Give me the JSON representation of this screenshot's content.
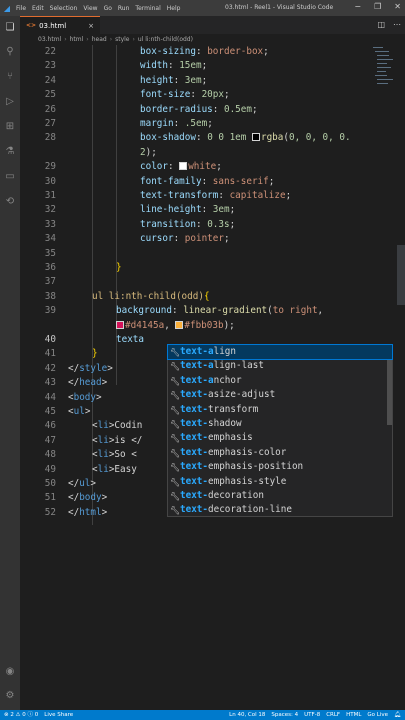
{
  "titlebar": {
    "menu": [
      "File",
      "Edit",
      "Selection",
      "View",
      "Go",
      "Run",
      "Terminal",
      "Help"
    ],
    "title": "03.html - Reel1 - Visual Studio Code"
  },
  "tab": {
    "badge": "<>",
    "name": "03.html",
    "close": "×"
  },
  "breadcrumb": [
    "03.html",
    "html",
    "head",
    "style",
    "ul li:nth-child(odd)"
  ],
  "editor": {
    "lines": [
      {
        "n": "22",
        "segments": [
          [
            "prop",
            "box-sizing"
          ],
          [
            "punc",
            ": "
          ],
          [
            "val",
            "border-box"
          ],
          [
            "punc",
            ";"
          ]
        ]
      },
      {
        "n": "23",
        "segments": [
          [
            "prop",
            "width"
          ],
          [
            "punc",
            ": "
          ],
          [
            "num",
            "15em"
          ],
          [
            "punc",
            ";"
          ]
        ]
      },
      {
        "n": "24",
        "segments": [
          [
            "prop",
            "height"
          ],
          [
            "punc",
            ": "
          ],
          [
            "num",
            "3em"
          ],
          [
            "punc",
            ";"
          ]
        ]
      },
      {
        "n": "25",
        "segments": [
          [
            "prop",
            "font-size"
          ],
          [
            "punc",
            ": "
          ],
          [
            "num",
            "20px"
          ],
          [
            "punc",
            ";"
          ]
        ]
      },
      {
        "n": "26",
        "segments": [
          [
            "prop",
            "border-radius"
          ],
          [
            "punc",
            ": "
          ],
          [
            "num",
            "0.5em"
          ],
          [
            "punc",
            ";"
          ]
        ]
      },
      {
        "n": "27",
        "segments": [
          [
            "prop",
            "margin"
          ],
          [
            "punc",
            ": "
          ],
          [
            "num",
            ".5em"
          ],
          [
            "punc",
            ";"
          ]
        ]
      },
      {
        "n": "28",
        "segments": [
          [
            "prop",
            "box-shadow"
          ],
          [
            "punc",
            ": "
          ],
          [
            "num",
            "0 0 1em "
          ],
          [
            "swatch",
            "#000000"
          ],
          [
            "func",
            "rgba"
          ],
          [
            "punc",
            "("
          ],
          [
            "num",
            "0, 0, 0, 0."
          ]
        ]
      },
      {
        "n": "",
        "segments": [
          [
            "num",
            "2"
          ],
          [
            "punc",
            ");"
          ]
        ]
      },
      {
        "n": "29",
        "segments": [
          [
            "prop",
            "color"
          ],
          [
            "punc",
            ": "
          ],
          [
            "swatch",
            "#ffffff"
          ],
          [
            "val",
            "white"
          ],
          [
            "punc",
            ";"
          ]
        ]
      },
      {
        "n": "30",
        "segments": [
          [
            "prop",
            "font-family"
          ],
          [
            "punc",
            ": "
          ],
          [
            "val",
            "sans-serif"
          ],
          [
            "punc",
            ";"
          ]
        ]
      },
      {
        "n": "31",
        "segments": [
          [
            "prop",
            "text-transform"
          ],
          [
            "punc",
            ": "
          ],
          [
            "val",
            "capitalize"
          ],
          [
            "punc",
            ";"
          ]
        ]
      },
      {
        "n": "32",
        "segments": [
          [
            "prop",
            "line-height"
          ],
          [
            "punc",
            ": "
          ],
          [
            "num",
            "3em"
          ],
          [
            "punc",
            ";"
          ]
        ]
      },
      {
        "n": "33",
        "segments": [
          [
            "prop",
            "transition"
          ],
          [
            "punc",
            ": "
          ],
          [
            "num",
            "0.3s"
          ],
          [
            "punc",
            ";"
          ]
        ]
      },
      {
        "n": "34",
        "segments": [
          [
            "prop",
            "cursor"
          ],
          [
            "punc",
            ": "
          ],
          [
            "val",
            "pointer"
          ],
          [
            "punc",
            ";"
          ]
        ]
      },
      {
        "n": "35",
        "segments": []
      },
      {
        "n": "36",
        "segments": [
          [
            "brace",
            "}"
          ]
        ]
      },
      {
        "n": "37",
        "segments": []
      },
      {
        "n": "38",
        "segments": [
          [
            "sel",
            "ul li:nth-child(odd)"
          ],
          [
            "brace",
            "{"
          ]
        ]
      },
      {
        "n": "39",
        "segments": [
          [
            "prop",
            "background"
          ],
          [
            "punc",
            ": "
          ],
          [
            "func",
            "linear-gradient"
          ],
          [
            "punc",
            "("
          ],
          [
            "val",
            "to right"
          ],
          [
            "punc",
            ","
          ]
        ]
      },
      {
        "n": "",
        "segments": [
          [
            "swatch",
            "#d4145a"
          ],
          [
            "val",
            "#d4145a"
          ],
          [
            "punc",
            ", "
          ],
          [
            "swatch",
            "#fbb03b"
          ],
          [
            "val",
            "#fbb03b"
          ],
          [
            "punc",
            ");"
          ]
        ]
      },
      {
        "n": "40",
        "segments": [
          [
            "prop",
            "texta"
          ]
        ]
      },
      {
        "n": "41",
        "segments": [
          [
            "brace",
            "}"
          ]
        ]
      },
      {
        "n": "42",
        "segments": [
          [
            "tagtext",
            "</"
          ],
          [
            "tag",
            "style"
          ],
          [
            "tagtext",
            ">"
          ]
        ]
      },
      {
        "n": "43",
        "segments": [
          [
            "tagtext",
            "</"
          ],
          [
            "tag",
            "head"
          ],
          [
            "tagtext",
            ">"
          ]
        ]
      },
      {
        "n": "44",
        "segments": [
          [
            "tagtext",
            "<"
          ],
          [
            "tag",
            "body"
          ],
          [
            "tagtext",
            ">"
          ]
        ]
      },
      {
        "n": "45",
        "segments": [
          [
            "tagtext",
            "<"
          ],
          [
            "tag",
            "ul"
          ],
          [
            "tagtext",
            ">"
          ]
        ]
      },
      {
        "n": "46",
        "segments": [
          [
            "tagtext",
            "<"
          ],
          [
            "tag",
            "li"
          ],
          [
            "tagtext",
            ">Codin"
          ]
        ]
      },
      {
        "n": "47",
        "segments": [
          [
            "tagtext",
            "<"
          ],
          [
            "tag",
            "li"
          ],
          [
            "tagtext",
            ">is </"
          ]
        ]
      },
      {
        "n": "48",
        "segments": [
          [
            "tagtext",
            "<"
          ],
          [
            "tag",
            "li"
          ],
          [
            "tagtext",
            ">So <"
          ]
        ]
      },
      {
        "n": "49",
        "segments": [
          [
            "tagtext",
            "<"
          ],
          [
            "tag",
            "li"
          ],
          [
            "tagtext",
            ">Easy"
          ]
        ]
      },
      {
        "n": "50",
        "segments": [
          [
            "tagtext",
            "</"
          ],
          [
            "tag",
            "ul"
          ],
          [
            "tagtext",
            ">"
          ]
        ]
      },
      {
        "n": "51",
        "segments": [
          [
            "tagtext",
            "</"
          ],
          [
            "tag",
            "body"
          ],
          [
            "tagtext",
            ">"
          ]
        ]
      },
      {
        "n": "52",
        "segments": [
          [
            "tagtext",
            "</"
          ],
          [
            "tag",
            "html"
          ],
          [
            "tagtext",
            ">"
          ]
        ]
      }
    ]
  },
  "suggest": {
    "items": [
      {
        "match": "text-a",
        "rest": "lign"
      },
      {
        "match": "text-a",
        "rest": "lign-last"
      },
      {
        "match": "text-a",
        "rest": "nchor"
      },
      {
        "match": "text-",
        "rest": "size-adjust",
        "mid": "a"
      },
      {
        "match": "text-",
        "rest": "transform",
        "mid": ""
      },
      {
        "match": "text-",
        "rest": "shadow",
        "mid": ""
      },
      {
        "match": "text-",
        "rest": "emphasis",
        "mid": ""
      },
      {
        "match": "text-",
        "rest": "emphasis-color",
        "mid": ""
      },
      {
        "match": "text-",
        "rest": "emphasis-position",
        "mid": ""
      },
      {
        "match": "text-",
        "rest": "emphasis-style",
        "mid": ""
      },
      {
        "match": "text-",
        "rest": "decoration",
        "mid": ""
      },
      {
        "match": "text-",
        "rest": "decoration-line",
        "mid": ""
      }
    ]
  },
  "statusbar": {
    "errors": "⊗ 2 ⚠ 0 ⓘ 0",
    "liveshare": "Live Share",
    "position": "Ln 40, Col 18",
    "spaces": "Spaces: 4",
    "encoding": "UTF-8",
    "eol": "CRLF",
    "language": "HTML",
    "golive": "Go Live"
  }
}
